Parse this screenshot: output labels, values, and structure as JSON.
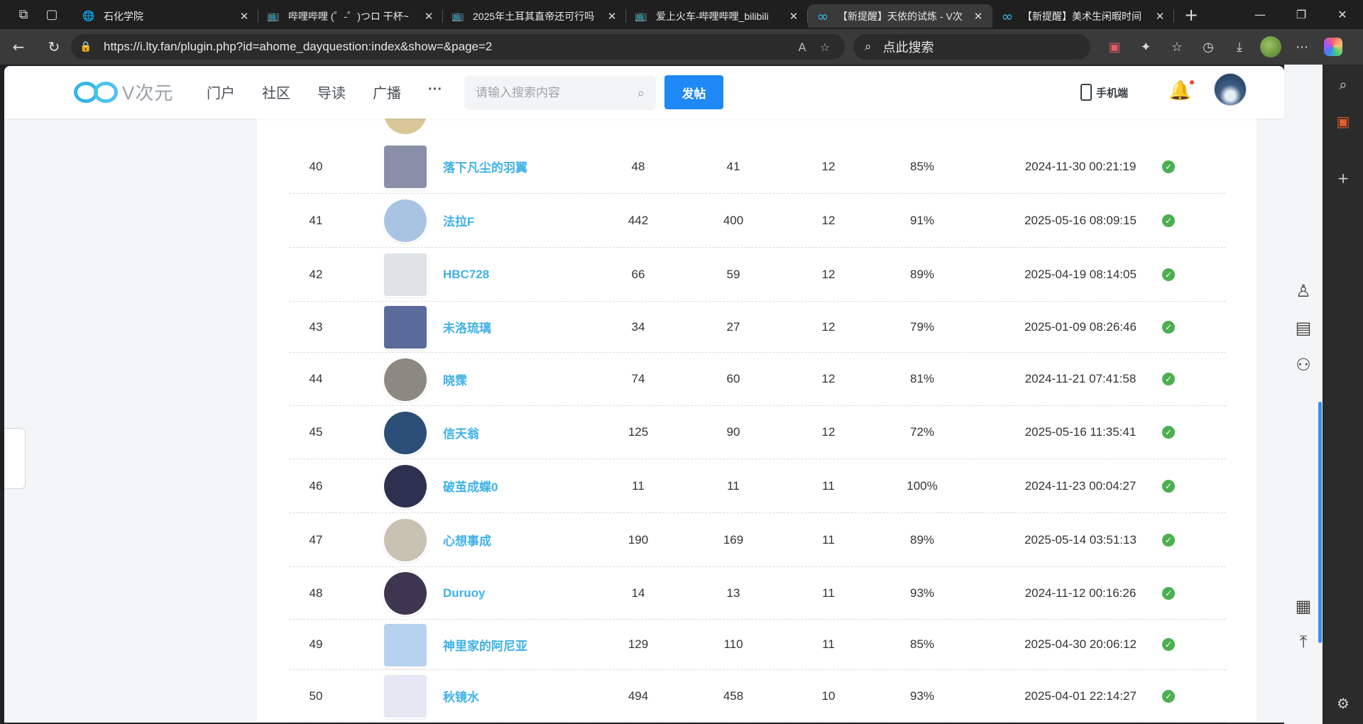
{
  "browser": {
    "tabs": [
      {
        "title": "石化学院",
        "icon": "globe-icon",
        "active": false
      },
      {
        "title": "哔哩哔哩 (゜-゜)つロ 干杯~",
        "icon": "bilibili-icon",
        "active": false
      },
      {
        "title": "2025年土耳其直帝还可行吗",
        "icon": "bilibili-icon",
        "active": false
      },
      {
        "title": "爱上火车-哔哩哔哩_bilibili",
        "icon": "bilibili-icon",
        "active": false
      },
      {
        "title": "【新提醒】天依的试炼 - V次",
        "icon": "infinity-icon",
        "active": true
      },
      {
        "title": "【新提醒】美术生闲暇时间",
        "icon": "infinity-icon",
        "active": false
      }
    ],
    "url": "https://i.lty.fan/plugin.php?id=ahome_dayquestion:index&show=&page=2",
    "search_placeholder": "点此搜索"
  },
  "site": {
    "logo_text": "V次元",
    "nav": [
      "门户",
      "社区",
      "导读",
      "广播"
    ],
    "more_label": "···",
    "search_placeholder": "请输入搜索内容",
    "post_button": "发帖",
    "mobile_label": "手机端"
  },
  "rows": [
    {
      "rank": "40",
      "name": "落下凡尘的羽翼",
      "c1": "48",
      "c2": "41",
      "c3": "12",
      "rate": "85%",
      "time": "2024-11-30 00:21:19",
      "avatar": "#8a8fa8"
    },
    {
      "rank": "41",
      "name": "法拉F",
      "c1": "442",
      "c2": "400",
      "c3": "12",
      "rate": "91%",
      "time": "2025-05-16 08:09:15",
      "avatar": "#a9c4e2"
    },
    {
      "rank": "42",
      "name": "HBC728",
      "c1": "66",
      "c2": "59",
      "c3": "12",
      "rate": "89%",
      "time": "2025-04-19 08:14:05",
      "avatar": "#dfe3e8"
    },
    {
      "rank": "43",
      "name": "未洛琉璃",
      "c1": "34",
      "c2": "27",
      "c3": "12",
      "rate": "79%",
      "time": "2025-01-09 08:26:46",
      "avatar": "#5a6a9a"
    },
    {
      "rank": "44",
      "name": "晓霂",
      "c1": "74",
      "c2": "60",
      "c3": "12",
      "rate": "81%",
      "time": "2024-11-21 07:41:58",
      "avatar": "#8c8a80"
    },
    {
      "rank": "45",
      "name": "信天翁",
      "c1": "125",
      "c2": "90",
      "c3": "12",
      "rate": "72%",
      "time": "2025-05-16 11:35:41",
      "avatar": "#2c4f78"
    },
    {
      "rank": "46",
      "name": "破茧成蝶0",
      "c1": "11",
      "c2": "11",
      "c3": "11",
      "rate": "100%",
      "time": "2024-11-23 00:04:27",
      "avatar": "#2e3050"
    },
    {
      "rank": "47",
      "name": "心想事成",
      "c1": "190",
      "c2": "169",
      "c3": "11",
      "rate": "89%",
      "time": "2025-05-14 03:51:13",
      "avatar": "#c9c2b2"
    },
    {
      "rank": "48",
      "name": "Duruoy",
      "c1": "14",
      "c2": "13",
      "c3": "11",
      "rate": "93%",
      "time": "2024-11-12 00:16:26",
      "avatar": "#3e3650"
    },
    {
      "rank": "49",
      "name": "神里家的阿尼亚",
      "c1": "129",
      "c2": "110",
      "c3": "11",
      "rate": "85%",
      "time": "2025-04-30 20:06:12",
      "avatar": "#b7d2ef"
    },
    {
      "rank": "50",
      "name": "秋镜水",
      "c1": "494",
      "c2": "458",
      "c3": "10",
      "rate": "93%",
      "time": "2025-04-01 22:14:27",
      "avatar": "#e5e8f2"
    }
  ]
}
